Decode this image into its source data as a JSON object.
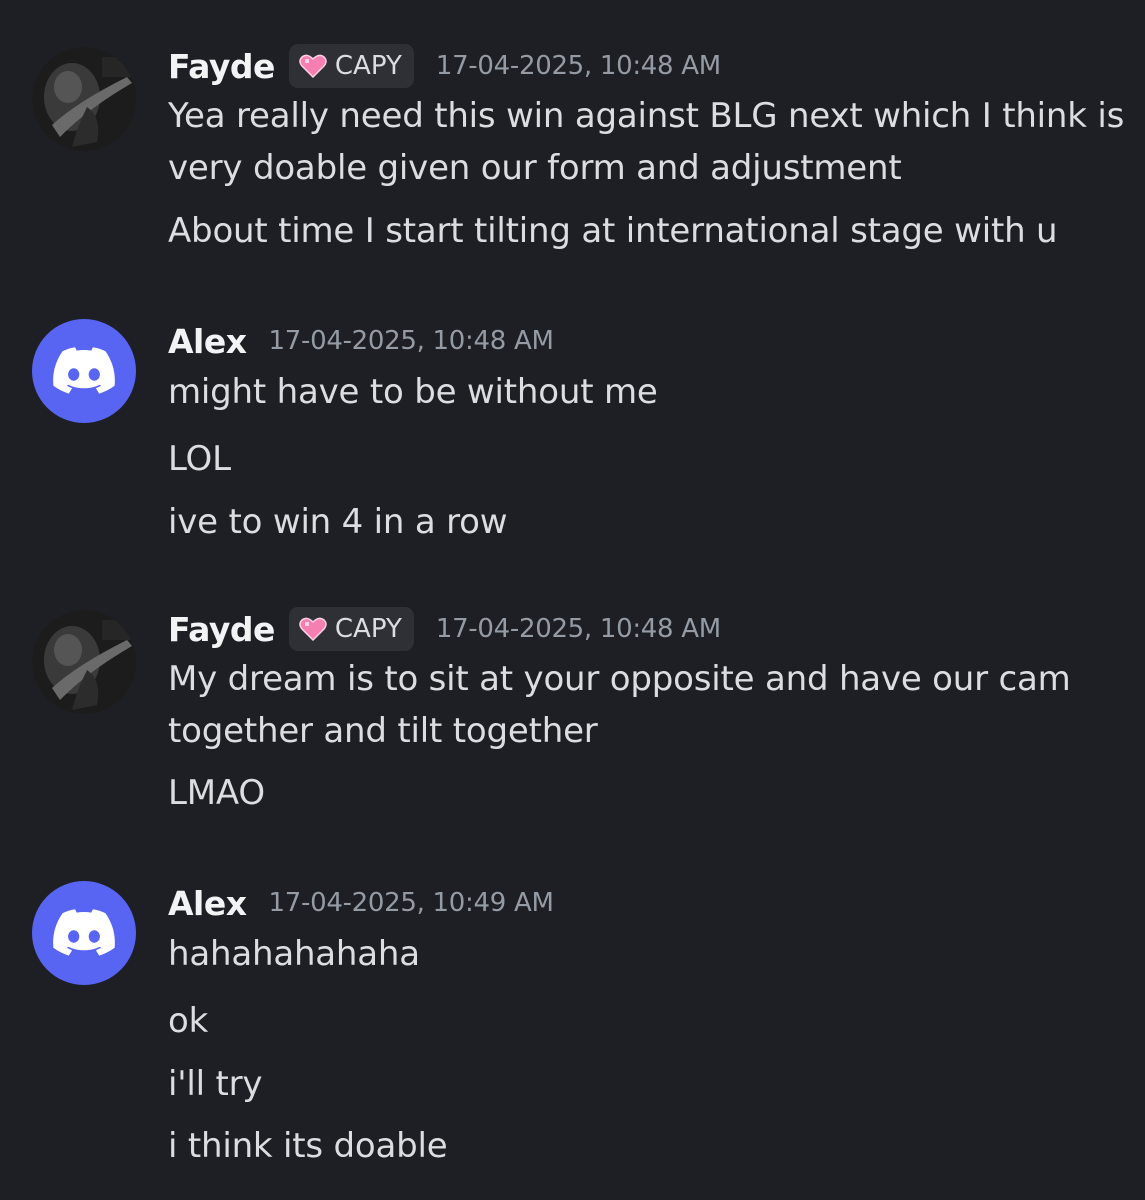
{
  "messages": [
    {
      "author": "Fayde",
      "tag": "CAPY",
      "timestamp": "17-04-2025, 10:48 AM",
      "lines": [
        "Yea really need this win against BLG next which I think is very doable given our form and adjustment",
        "About time I start tilting at international stage with u"
      ]
    },
    {
      "author": "Alex",
      "timestamp": "17-04-2025, 10:48 AM",
      "lines": [
        "might have to be without me",
        "LOL",
        "ive to win 4 in a row"
      ]
    },
    {
      "author": "Fayde",
      "tag": "CAPY",
      "timestamp": "17-04-2025, 10:48 AM",
      "lines": [
        "My dream is to sit at your opposite and have our cam together and tilt together",
        "LMAO"
      ]
    },
    {
      "author": "Alex",
      "timestamp": "17-04-2025, 10:49 AM",
      "lines": [
        "hahahahahaha",
        "ok",
        "i'll try",
        "i think its doable"
      ]
    }
  ],
  "colors": {
    "background": "#1e1f24",
    "discord_blurple": "#5865f2",
    "text": "#dbdee1",
    "timestamp": "#949ba4",
    "tag_background": "#2e3036",
    "heart": "#f47fb0"
  },
  "icons": {
    "discord_avatar": "discord-logo-icon",
    "tag": "pink-heart-icon",
    "fayde_avatar": "user-photo-avatar"
  }
}
